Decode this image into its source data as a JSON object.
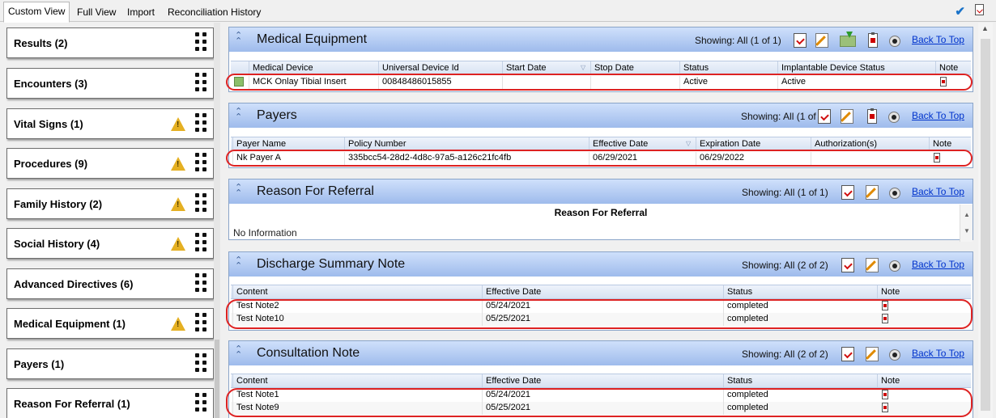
{
  "tabs": [
    {
      "label": "Custom View",
      "active": true
    },
    {
      "label": "Full View",
      "active": false
    },
    {
      "label": "Import",
      "active": false
    },
    {
      "label": "Reconciliation History",
      "active": false
    }
  ],
  "nav": [
    {
      "label": "Results (2)",
      "warning": false
    },
    {
      "label": "Encounters (3)",
      "warning": false
    },
    {
      "label": "Vital Signs (1)",
      "warning": true
    },
    {
      "label": "Procedures (9)",
      "warning": true
    },
    {
      "label": "Family History (2)",
      "warning": true
    },
    {
      "label": "Social History (4)",
      "warning": true
    },
    {
      "label": "Advanced Directives (6)",
      "warning": false
    },
    {
      "label": "Medical Equipment (1)",
      "warning": true
    },
    {
      "label": "Payers (1)",
      "warning": false
    },
    {
      "label": "Reason For Referral (1)",
      "warning": false
    }
  ],
  "back_to_top": "Back To Top",
  "medical_equipment": {
    "title": "Medical Equipment",
    "showing": "Showing: All (1 of 1)",
    "columns": [
      "Medical Device",
      "Universal Device Id",
      "Start Date",
      "Stop Date",
      "Status",
      "Implantable Device Status",
      "Note"
    ],
    "rows": [
      [
        "MCK Onlay Tibial Insert",
        "00848486015855",
        "",
        "",
        "Active",
        "Active",
        ""
      ]
    ]
  },
  "payers": {
    "title": "Payers",
    "showing": "Showing: All (1 of 1)",
    "columns": [
      "Payer Name",
      "Policy Number",
      "Effective Date",
      "Expiration Date",
      "Authorization(s)",
      "Note"
    ],
    "rows": [
      [
        "Nk Payer A",
        "335bcc54-28d2-4d8c-97a5-a126c21fc4fb",
        "06/29/2021",
        "06/29/2022",
        "",
        ""
      ]
    ]
  },
  "reason_for_referral": {
    "title": "Reason For Referral",
    "showing": "Showing: All (1 of 1)",
    "header": "Reason For Referral",
    "content": "No Information"
  },
  "discharge_summary": {
    "title": "Discharge Summary Note",
    "showing": "Showing: All (2 of 2)",
    "columns": [
      "Content",
      "Effective Date",
      "Status",
      "Note"
    ],
    "rows": [
      [
        "Test Note2",
        "05/24/2021",
        "completed",
        ""
      ],
      [
        "Test Note10",
        "05/25/2021",
        "completed",
        ""
      ]
    ]
  },
  "consultation": {
    "title": "Consultation Note",
    "showing": "Showing: All (2 of 2)",
    "columns": [
      "Content",
      "Effective Date",
      "Status",
      "Note"
    ],
    "rows": [
      [
        "Test Note1",
        "05/24/2021",
        "completed",
        ""
      ],
      [
        "Test Note9",
        "05/25/2021",
        "completed",
        ""
      ]
    ]
  },
  "colors": {
    "highlight_ring": "#dd2222",
    "header_blue": "#9ebbec",
    "link": "#0033cc",
    "warning": "#e5b022"
  }
}
